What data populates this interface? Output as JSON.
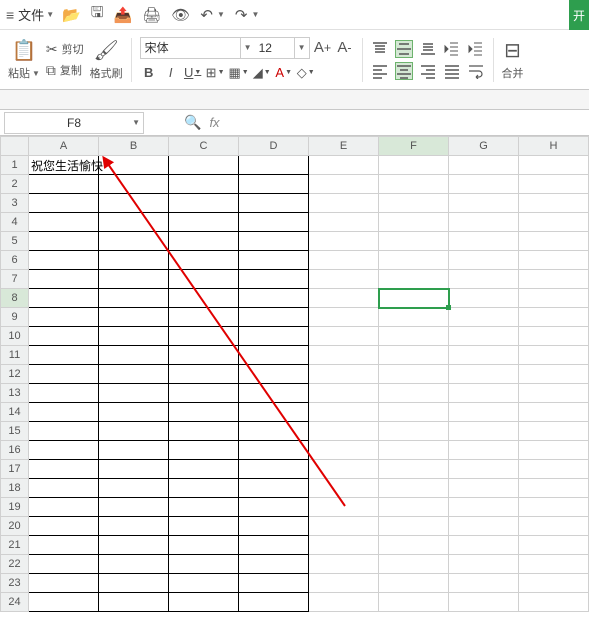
{
  "menubar": {
    "file_label": "文件",
    "right_button": "开"
  },
  "ribbon": {
    "paste_label": "粘贴",
    "cut_label": "剪切",
    "copy_label": "复制",
    "format_painter_label": "格式刷",
    "font_name": "宋体",
    "font_size": "12",
    "merge_label": "合并"
  },
  "namebox": {
    "value": "F8"
  },
  "cells": {
    "A1": "祝您生活愉快"
  },
  "columns": [
    "A",
    "B",
    "C",
    "D",
    "E",
    "F",
    "G",
    "H"
  ],
  "rows": [
    "1",
    "2",
    "3",
    "4",
    "5",
    "6",
    "7",
    "8",
    "9",
    "10",
    "11",
    "12",
    "13",
    "14",
    "15",
    "16",
    "17",
    "18",
    "19",
    "20",
    "21",
    "22",
    "23",
    "24"
  ],
  "selection": {
    "col": "F",
    "row": "8"
  },
  "bordered_range": {
    "cols": [
      "A",
      "B",
      "C",
      "D"
    ],
    "rows_from": 1,
    "rows_to": 24
  }
}
